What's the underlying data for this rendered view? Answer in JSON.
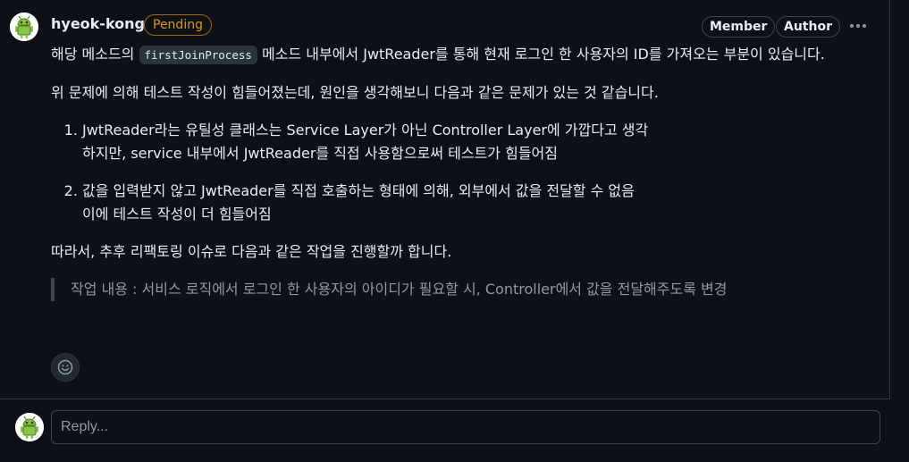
{
  "comment": {
    "author": "hyeok-kong",
    "status_badge": "Pending",
    "member_badge": "Member",
    "author_badge": "Author",
    "paragraph1_before": "해당 메소드의 ",
    "paragraph1_code": "firstJoinProcess",
    "paragraph1_after": " 메소드 내부에서 JwtReader를 통해 현재 로그인 한 사용자의 ID를 가져오는 부분이 있습니다.",
    "paragraph2": "위 문제에 의해 테스트 작성이 힘들어졌는데, 원인을 생각해보니 다음과 같은 문제가 있는 것 같습니다.",
    "list": [
      {
        "line1": "JwtReader라는 유틸성 클래스는 Service Layer가 아닌 Controller Layer에 가깝다고 생각",
        "line2": "하지만, service 내부에서 JwtReader를 직접 사용함으로써 테스트가 힘들어짐"
      },
      {
        "line1": "값을 입력받지 않고 JwtReader를 직접 호출하는 형태에 의해, 외부에서 값을 전달할 수 없음",
        "line2": "이에 테스트 작성이 더 힘들어짐"
      }
    ],
    "paragraph3": "따라서, 추후 리팩토링 이슈로 다음과 같은 작업을 진행할까 합니다.",
    "quote": "작업 내용 : 서비스 로직에서 로그인 한 사용자의 아이디가 필요할 시, Controller에서 값을 전달해주도록 변경"
  },
  "reply": {
    "placeholder": "Reply..."
  },
  "icons": {
    "avatar": "android-avatar-icon",
    "menu": "kebab-horizontal-icon",
    "reaction": "smiley-icon"
  },
  "colors": {
    "background": "#0d1117",
    "pending": "#d29922",
    "muted": "#9198a1",
    "avatar_green": "#8bc34a"
  }
}
